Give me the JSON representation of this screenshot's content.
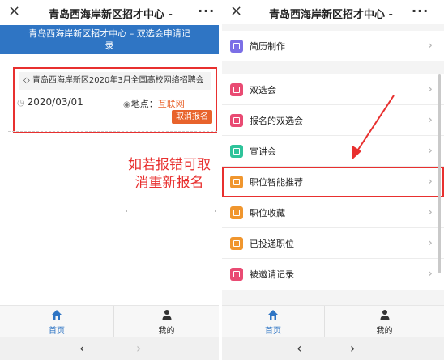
{
  "left": {
    "titlebar": {
      "close": "×",
      "title": "青岛西海岸新区招才中心 - ",
      "more": "···"
    },
    "banner": "青岛西海岸新区招才中心 – 双选会申请记录",
    "event": {
      "title": "◇ 青岛西海岸新区2020年3月全国高校网络招聘会",
      "date": "2020/03/01",
      "location_label": "地点：",
      "location_value": "互联网",
      "cancel_button": "取消报名"
    },
    "annotation": "如若报错可取消重新报名"
  },
  "right": {
    "titlebar": {
      "close": "×",
      "title": "青岛西海岸新区招才中心 - ",
      "more": "···"
    },
    "menu_top": [
      {
        "label": "简历制作",
        "color": "#7b6fe6"
      }
    ],
    "menu_main": [
      {
        "label": "双选会",
        "color": "#e94b73"
      },
      {
        "label": "报名的双选会",
        "color": "#e94b73"
      },
      {
        "label": "宣讲会",
        "color": "#2ec39a"
      },
      {
        "label": "职位智能推荐",
        "color": "#f0962e"
      },
      {
        "label": "职位收藏",
        "color": "#f0962e"
      },
      {
        "label": "已投递职位",
        "color": "#f0962e"
      },
      {
        "label": "被邀请记录",
        "color": "#e94b73"
      }
    ]
  },
  "tabbar": {
    "home_label": "首页",
    "mine_label": "我的"
  },
  "navbar": {
    "back": "‹",
    "forward": "›"
  },
  "colors": {
    "primary_blue": "#2f75c4",
    "annotation_red": "#e8302f",
    "accent_orange": "#e8632c"
  }
}
